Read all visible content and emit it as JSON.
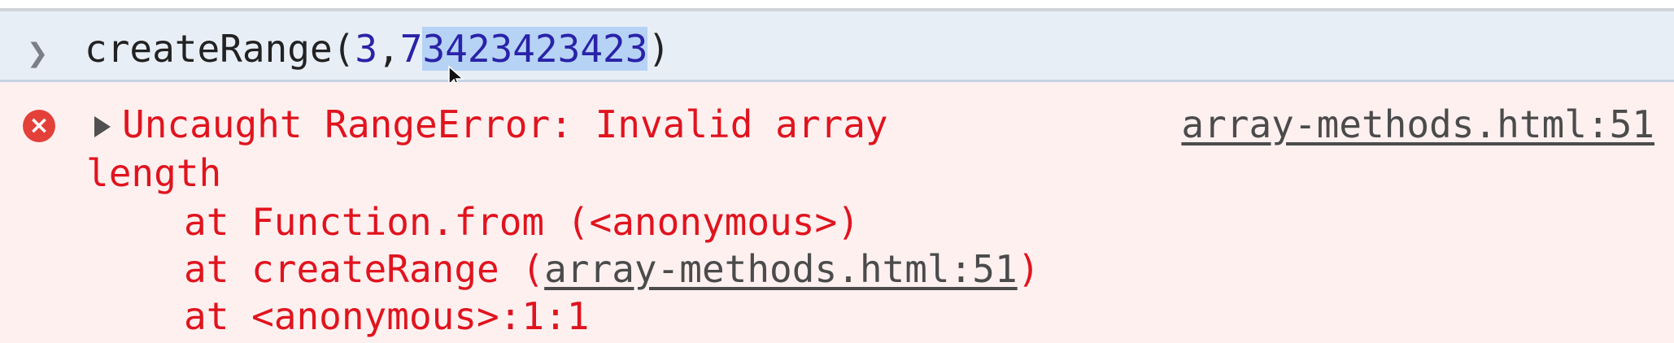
{
  "input": {
    "prompt_icon": "chevron-right-icon",
    "function_name": "createRange",
    "open_paren": "(",
    "arg1": "3",
    "comma": ",",
    "arg2_unselected": "7",
    "arg2_selected": "3423423423",
    "close_paren": ")"
  },
  "error": {
    "badge_glyph": "×",
    "badge_icon": "error-icon",
    "message_line1": "Uncaught RangeError: Invalid array",
    "message_line2": "length",
    "source_link": "array-methods.html:51",
    "stack": [
      {
        "text": "at Function.from (<anonymous>)"
      },
      {
        "prefix": "at createRange (",
        "link": "array-methods.html:51",
        "suffix": ")"
      },
      {
        "text": "at <anonymous>:1:1"
      }
    ]
  },
  "colors": {
    "input_bg": "#e8eef6",
    "error_bg": "#fff0f0",
    "error_text": "#e0141e",
    "number_text": "#2a22a8",
    "selection_bg": "#b6d3f5",
    "error_badge": "#e4403a"
  }
}
